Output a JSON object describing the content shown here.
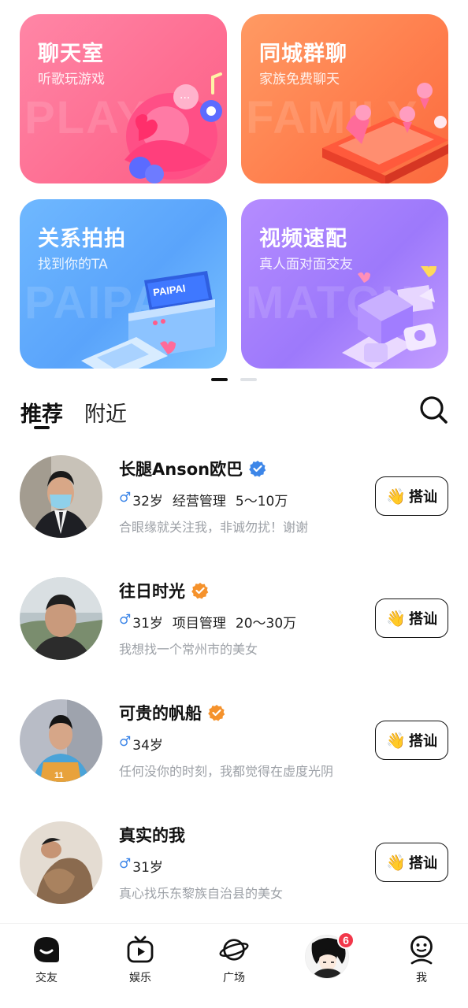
{
  "feature_cards": [
    {
      "title": "聊天室",
      "subtitle": "听歌玩游戏",
      "watermark": "PLAY",
      "color": "#fe6f93"
    },
    {
      "title": "同城群聊",
      "subtitle": "家族免费聊天",
      "watermark": "FAMILY",
      "color": "#ff7f4e"
    },
    {
      "title": "关系拍拍",
      "subtitle": "找到你的TA",
      "watermark": "PAIPAI",
      "color": "#5aa4fb",
      "art_label": "PAIPAI"
    },
    {
      "title": "视频速配",
      "subtitle": "真人面对面交友",
      "watermark": "MATCH",
      "color": "#9d79fb"
    }
  ],
  "pager": {
    "total": 2,
    "active_index": 0
  },
  "tabs": {
    "recommend": "推荐",
    "nearby": "附近",
    "active": "推荐"
  },
  "users": [
    {
      "name": "长腿Anson欧巴",
      "badge": "verified-blue",
      "gender": "♂",
      "age": "32岁",
      "job": "经营管理",
      "income": "5～10万",
      "bio": "合眼缘就关注我，非诚勿扰！谢谢",
      "button": "搭讪"
    },
    {
      "name": "往日时光",
      "badge": "verified-orange",
      "gender": "♂",
      "age": "31岁",
      "job": "项目管理",
      "income": "20～30万",
      "bio": "我想找一个常州市的美女",
      "button": "搭讪"
    },
    {
      "name": "可贵的帆船",
      "badge": "verified-orange",
      "gender": "♂",
      "age": "34岁",
      "job": "",
      "income": "",
      "bio": "任何没你的时刻，我都觉得在虚度光阴",
      "button": "搭讪"
    },
    {
      "name": "真实的我",
      "badge": "",
      "gender": "♂",
      "age": "31岁",
      "job": "",
      "income": "",
      "bio": "真心找乐东黎族自治县的美女",
      "button": "搭讪"
    }
  ],
  "colors": {
    "blue_badge": "#3d86e8",
    "orange_badge": "#f5922c",
    "notify_red": "#f2374a"
  },
  "bottom_nav": {
    "items": [
      {
        "label": "交友",
        "icon": "chat-bubble-icon",
        "active": true
      },
      {
        "label": "娱乐",
        "icon": "tv-play-icon"
      },
      {
        "label": "广场",
        "icon": "planet-icon"
      },
      {
        "label": "",
        "icon": "center-avatar",
        "badge": "6"
      },
      {
        "label": "我",
        "icon": "person-face-icon"
      }
    ]
  }
}
